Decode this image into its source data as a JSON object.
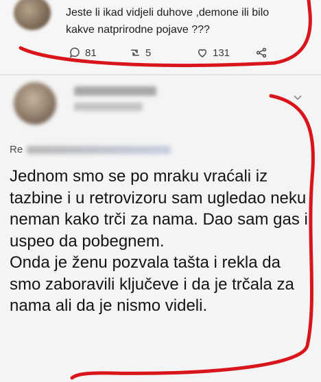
{
  "top_tweet": {
    "text": "Jeste li ikad vidjeli duhove ,demone ili bilo kakve natprirodne pojave ???",
    "replies": "81",
    "retweets": "5",
    "likes": "131"
  },
  "reply_tweet": {
    "reply_prefix": "Re",
    "paragraph1": "Jednom smo se po mraku vraćali iz tazbine i u retrovizoru sam ugledao neku neman kako trči za nama. Dao sam gas i uspeo da pobegnem.",
    "paragraph2": "Onda je ženu pozvala tašta i rekla da smo zaboravili ključeve i da je trčala za nama ali da je nismo videli."
  },
  "colors": {
    "annotation": "#d8151b",
    "icon": "#4a4a4a"
  },
  "icons": [
    "reply-icon",
    "retweet-icon",
    "heart-icon",
    "share-icon",
    "chevron-down-icon"
  ]
}
